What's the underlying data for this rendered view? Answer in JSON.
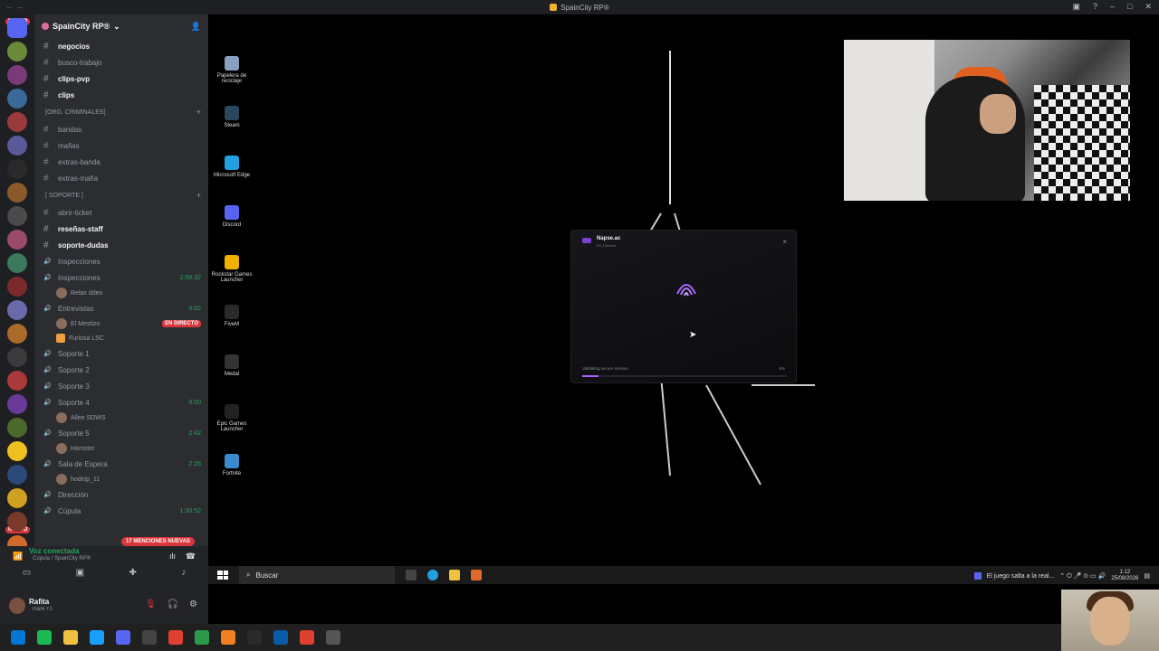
{
  "window": {
    "title": "SpainCity RP®"
  },
  "servers": {
    "new_label": "NUEVO",
    "new_label_bottom": "NUEVO",
    "badges": [
      "41",
      "484",
      "35"
    ],
    "colors": [
      "#5865f2",
      "#6a8a3a",
      "#7a3a7a",
      "#3a6a9a",
      "#9a3a3a",
      "#5a5a9a",
      "#2a2a2a",
      "#8a5a2a",
      "#4a4a4a",
      "#9a4a6a",
      "#3a7a5a",
      "#7a2a2a",
      "#6a6aaa",
      "#aa6a2a",
      "#3a3a3a",
      "#aa3a3a",
      "#6a3a9a",
      "#4a6a2a",
      "#f0c020",
      "#2a4a7a",
      "#d0a020",
      "#7a3a2a",
      "#cf6a2a",
      "#4a7a3a",
      "#7a7a2a",
      "#da373c"
    ]
  },
  "sidebar": {
    "server_name": "SpainCity RP®",
    "items": [
      {
        "type": "ch",
        "label": "negocios",
        "bold": true
      },
      {
        "type": "ch",
        "label": "busco-trabajo"
      },
      {
        "type": "ch",
        "label": "clips-pvp",
        "bold": true
      },
      {
        "type": "ch",
        "label": "clips",
        "bold": true
      },
      {
        "type": "cat",
        "label": "[ORG. CRIMINALES]"
      },
      {
        "type": "ch",
        "label": "bandas"
      },
      {
        "type": "ch",
        "label": "mafias"
      },
      {
        "type": "ch",
        "label": "extras-banda"
      },
      {
        "type": "ch",
        "label": "extras-mafia"
      },
      {
        "type": "cat",
        "label": "[ SOPORTE ]"
      },
      {
        "type": "ch",
        "label": "abrir-ticket"
      },
      {
        "type": "ch",
        "label": "reseñas-staff",
        "bold": true
      },
      {
        "type": "ch",
        "label": "soporte-dudas",
        "bold": true
      },
      {
        "type": "vc",
        "label": "Inspecciones"
      },
      {
        "type": "vc",
        "label": "Inspecciones",
        "time": "2:58:32"
      },
      {
        "type": "vu",
        "label": "Relax  ddeo"
      },
      {
        "type": "vc",
        "label": "Entrevistas",
        "time": "4:02"
      },
      {
        "type": "vu",
        "label": "El Mestizo",
        "live": "EN DIRECTO"
      },
      {
        "type": "vu",
        "label": "Furiosa  LSC",
        "sq": true
      },
      {
        "type": "vc",
        "label": "Soporte 1"
      },
      {
        "type": "vc",
        "label": "Soporte 2"
      },
      {
        "type": "vc",
        "label": "Soporte 3"
      },
      {
        "type": "vc",
        "label": "Soporte 4",
        "time": "0:00"
      },
      {
        "type": "vu",
        "label": "Allee  SDWS"
      },
      {
        "type": "vc",
        "label": "Soporte 5",
        "time": "2:42"
      },
      {
        "type": "vu",
        "label": "Hamster"
      },
      {
        "type": "vc",
        "label": "Sala de Espera",
        "time": "2:26"
      },
      {
        "type": "vu",
        "label": "hodeip_11"
      },
      {
        "type": "vc",
        "label": "Dirección"
      },
      {
        "type": "vc",
        "label": "Cúpula",
        "time": "1:30:52"
      }
    ],
    "mentions": "17 MENCIONES NUEVAS"
  },
  "voice": {
    "title": "Voz conectada",
    "sub": "Cúpula / SpainCity RP®"
  },
  "user": {
    "name": "Rafita",
    "status": "mark +1"
  },
  "desktop_icons": [
    {
      "label": "Papelera de reciclaje",
      "color": "#8aa0c0"
    },
    {
      "label": "Steam",
      "color": "#2a475e"
    },
    {
      "label": "Microsoft Edge",
      "color": "#1fa0e0"
    },
    {
      "label": "Discord",
      "color": "#5865f2"
    },
    {
      "label": "Rockstar Games Launcher",
      "color": "#f0b000"
    },
    {
      "label": "FiveM",
      "color": "#2a2a2a"
    },
    {
      "label": "Medal",
      "color": "#333333"
    },
    {
      "label": "Epic Games Launcher",
      "color": "#222222"
    },
    {
      "label": "Fortnite",
      "color": "#3a8ad0"
    }
  ],
  "napse": {
    "name": "Napse.ac",
    "sub": "PC-Checker",
    "status": "Validating secure session",
    "percent_label": "5%",
    "progress": 0.08,
    "accent": "#a763ff"
  },
  "taskbar": {
    "search": "Buscar",
    "news": "El juego salta a la real...",
    "time": "1:12",
    "date": "25/08/2026"
  }
}
